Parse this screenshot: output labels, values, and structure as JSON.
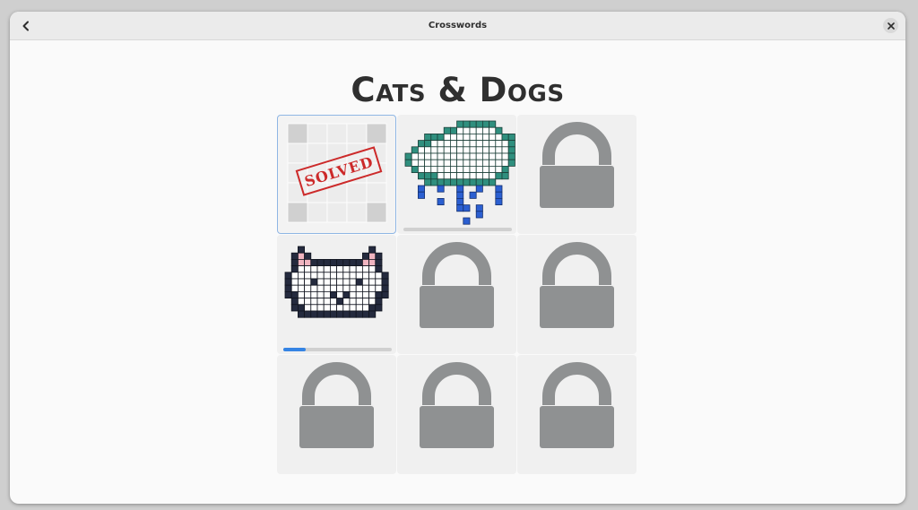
{
  "header": {
    "title": "Crosswords",
    "back_icon": "chevron-left-icon",
    "close_icon": "close-icon"
  },
  "puzzle_set": {
    "title": "Cats & Dogs"
  },
  "tiles": [
    {
      "state": "solved",
      "stamp_text": "SOLVED",
      "progress": 1.0
    },
    {
      "state": "in-progress",
      "picture": "rain-cloud",
      "progress": 0.0
    },
    {
      "state": "locked",
      "icon": "lock-icon"
    },
    {
      "state": "in-progress",
      "picture": "cat-face",
      "progress": 0.21
    },
    {
      "state": "locked",
      "icon": "lock-icon"
    },
    {
      "state": "locked",
      "icon": "lock-icon"
    },
    {
      "state": "locked",
      "icon": "lock-icon"
    },
    {
      "state": "locked",
      "icon": "lock-icon"
    },
    {
      "state": "locked",
      "icon": "lock-icon"
    }
  ],
  "colors": {
    "accent": "#3584e4",
    "lock": "#8f9192",
    "stamp": "#cc2a2a",
    "cloud_dark": "#2f8f7e",
    "rain": "#2b5fd1",
    "cat_outline": "#242a3e",
    "cat_ear": "#f0b4c0"
  }
}
